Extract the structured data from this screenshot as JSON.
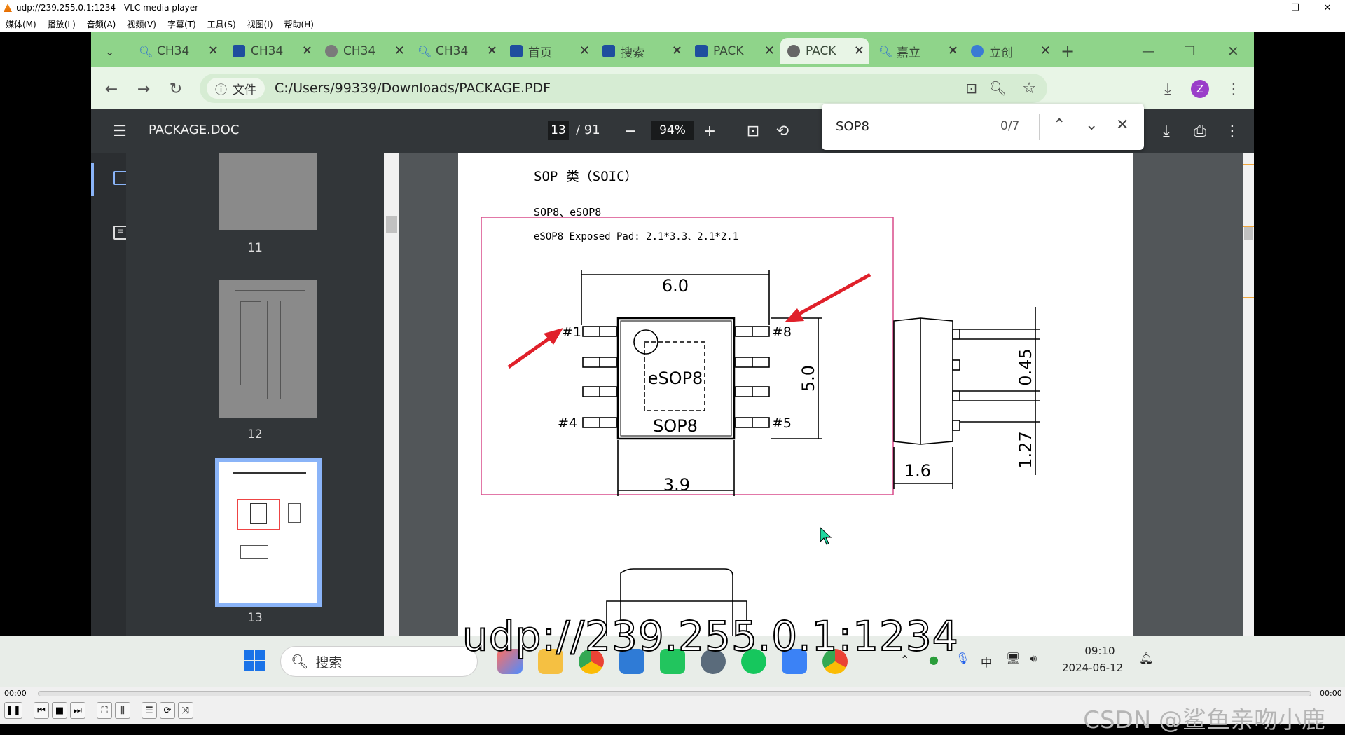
{
  "vlc": {
    "title": "udp://239.255.0.1:1234 - VLC media player",
    "menu": [
      "媒体(M)",
      "播放(L)",
      "音频(A)",
      "视频(V)",
      "字幕(T)",
      "工具(S)",
      "视图(I)",
      "帮助(H)"
    ],
    "time_current": "00:00",
    "time_total": "00:00",
    "watermark": "CSDN @鲨鱼亲吻小鹿"
  },
  "browser": {
    "tabs": [
      {
        "label": "CH34",
        "icon": "search-icon"
      },
      {
        "label": "CH34",
        "icon": "site-icon"
      },
      {
        "label": "CH34",
        "icon": "globe-icon"
      },
      {
        "label": "CH34",
        "icon": "search-icon"
      },
      {
        "label": "首页",
        "icon": "site-icon"
      },
      {
        "label": "搜索",
        "icon": "site-icon"
      },
      {
        "label": "PACK",
        "icon": "site-icon"
      },
      {
        "label": "PACK",
        "icon": "globe-icon"
      },
      {
        "label": "嘉立",
        "icon": "search-icon"
      },
      {
        "label": "立创",
        "icon": "cloud-icon"
      }
    ],
    "address": {
      "chip": "文件",
      "url": "C:/Users/99339/Downloads/PACKAGE.PDF"
    },
    "profile_initial": "Z"
  },
  "pdf": {
    "title": "PACKAGE.DOC",
    "page_current": "13",
    "page_total": "/ 91",
    "zoom": "94%",
    "find": {
      "query": "SOP8",
      "count": "0/7"
    },
    "thumbnails": [
      {
        "label": "11"
      },
      {
        "label": "12"
      },
      {
        "label": "13"
      }
    ],
    "page_content": {
      "heading": "SOP 类（SOIC）",
      "subheading": "SOP8、eSOP8",
      "note": "eSOP8 Exposed Pad: 2.1*3.3、2.1*2.1",
      "dims": {
        "top_width": "6.0",
        "height": "5.0",
        "bottom_width": "3.9",
        "pitch": "1.27",
        "lead": "0.45",
        "side": "1.6"
      },
      "pins": {
        "p1": "#1",
        "p4": "#4",
        "p5": "#5",
        "p8": "#8"
      },
      "labels": {
        "inner": "eSOP8",
        "outer": "SOP8"
      }
    }
  },
  "overlay": {
    "url": "udp://239.255.0.1:1234"
  },
  "taskbar": {
    "search": "搜索",
    "ime": "中",
    "time": "09:10",
    "date": "2024-06-12"
  },
  "colors": {
    "tab_strip": "#8fd48a",
    "toolbar": "#323639",
    "highlight": "#8ab4f8",
    "arrow": "#e0202a"
  }
}
